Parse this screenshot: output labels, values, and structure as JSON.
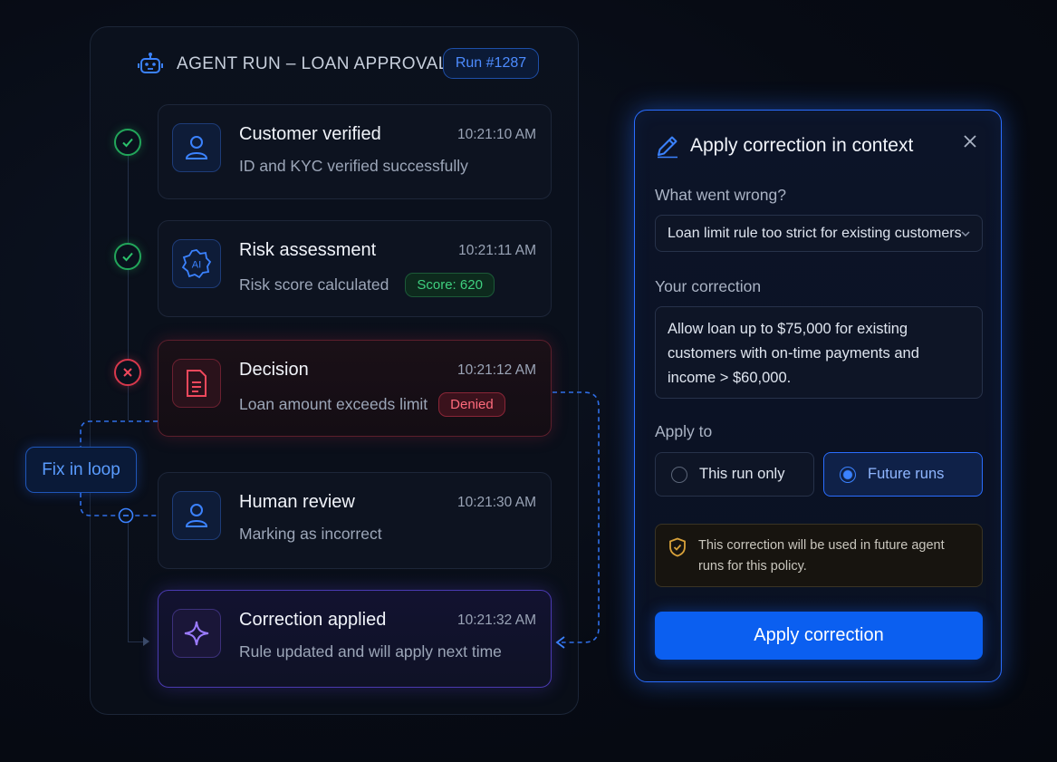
{
  "run": {
    "title": "AGENT RUN – LOAN APPROVAL",
    "badge": "Run #1287",
    "steps": [
      {
        "title": "Customer verified",
        "time": "10:21:10 AM",
        "desc": "ID and KYC verified successfully",
        "status": "ok",
        "icon": "user-icon"
      },
      {
        "title": "Risk assessment",
        "time": "10:21:11 AM",
        "desc": "Risk score calculated",
        "pill": "Score: 620",
        "status": "ok",
        "icon": "ai-badge-icon",
        "icon_text": "AI"
      },
      {
        "title": "Decision",
        "time": "10:21:12 AM",
        "desc": "Loan amount exceeds limit",
        "pill": "Denied",
        "status": "error",
        "icon": "document-icon"
      },
      {
        "title": "Human review",
        "time": "10:21:30 AM",
        "desc": "Marking as incorrect",
        "icon": "user-icon"
      },
      {
        "title": "Correction applied",
        "time": "10:21:32 AM",
        "desc": "Rule updated and will apply next time",
        "icon": "sparkle-icon"
      }
    ],
    "fix_label": "Fix in loop"
  },
  "correction": {
    "title": "Apply correction in context",
    "what_label": "What went wrong?",
    "what_value": "Loan limit rule too strict for existing customers",
    "your_label": "Your correction",
    "your_value": "Allow loan up to $75,000 for existing customers with on-time payments and income > $60,000.",
    "apply_to_label": "Apply to",
    "options": [
      {
        "label": "This run only",
        "selected": false
      },
      {
        "label": "Future runs",
        "selected": true
      }
    ],
    "notice": "This correction will be used in future agent runs for this policy.",
    "button": "Apply correction"
  },
  "colors": {
    "accent": "#0b5ff0",
    "success": "#22a55a",
    "error": "#d6384c",
    "warning": "#d9a23a"
  }
}
